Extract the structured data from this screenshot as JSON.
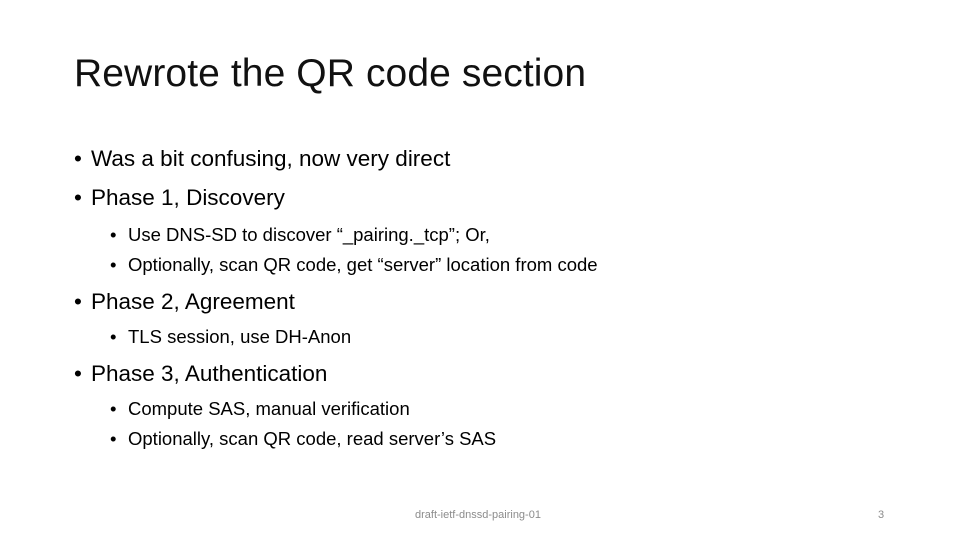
{
  "slide": {
    "title": "Rewrote the QR code section",
    "bullets": [
      {
        "level": 1,
        "text": "Was a bit confusing, now very direct"
      },
      {
        "level": 1,
        "text": "Phase 1, Discovery"
      },
      {
        "level": 2,
        "text": "Use DNS-SD to discover “_pairing._tcp”; Or,"
      },
      {
        "level": 2,
        "text": "Optionally, scan QR code, get “server” location from code"
      },
      {
        "level": 1,
        "text": "Phase 2, Agreement"
      },
      {
        "level": 2,
        "text": "TLS session, use DH-Anon"
      },
      {
        "level": 1,
        "text": "Phase 3, Authentication"
      },
      {
        "level": 2,
        "text": "Compute SAS, manual verification"
      },
      {
        "level": 2,
        "text": "Optionally, scan QR code, read server’s SAS"
      }
    ],
    "bullet_glyph": "•",
    "footer": "draft-ietf-dnssd-pairing-01",
    "page_number": "3"
  }
}
